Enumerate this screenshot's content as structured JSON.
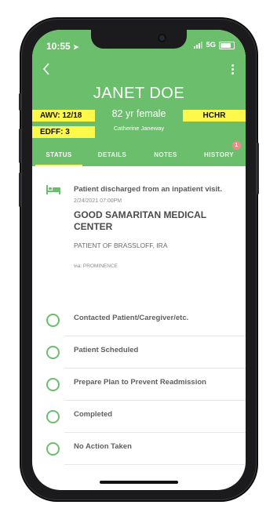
{
  "status_bar": {
    "time": "10:55",
    "network": "5G"
  },
  "patient": {
    "name": "JANET DOE",
    "age_sex": "82 yr female",
    "caregiver": "Catherine Janeway"
  },
  "badges": {
    "awv": "AWV: 12/18",
    "edff": "EDFF: 3",
    "hchr": "HCHR"
  },
  "tabs": [
    {
      "label": "STATUS",
      "active": true
    },
    {
      "label": "DETAILS"
    },
    {
      "label": "NOTES"
    },
    {
      "label": "HISTORY",
      "badge": "1"
    }
  ],
  "event": {
    "title": "Patient discharged from an inpatient visit.",
    "time": "2/24/2021 07:00PM",
    "facility": "GOOD SAMARITAN MEDICAL CENTER",
    "patient_of": "PATIENT OF BRASSLOFF, IRA",
    "via": "via: PROMINENCE"
  },
  "actions": [
    {
      "label": "Contacted Patient/Caregiver/etc."
    },
    {
      "label": "Patient Scheduled"
    },
    {
      "label": "Prepare Plan to Prevent Readmission"
    },
    {
      "label": "Completed"
    },
    {
      "label": "No Action Taken"
    }
  ],
  "colors": {
    "header": "#6bbf6c",
    "badge": "#fdf84a",
    "accent": "#6bbf6c"
  },
  "icons": [
    "back-icon",
    "more-icon",
    "bed-icon",
    "location-arrow-icon",
    "signal-icon",
    "battery-icon"
  ]
}
